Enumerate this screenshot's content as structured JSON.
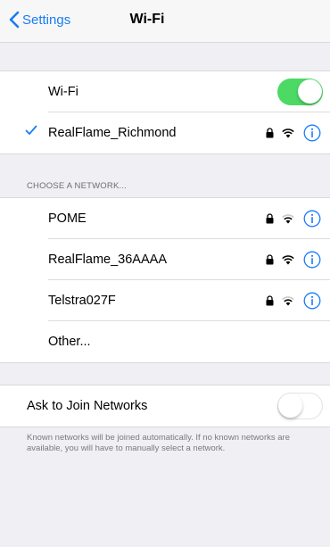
{
  "navbar": {
    "back_label": "Settings",
    "title": "Wi-Fi"
  },
  "wifi_toggle": {
    "label": "Wi-Fi",
    "state": "on"
  },
  "connected_network": {
    "name": "RealFlame_Richmond",
    "secured": true
  },
  "networks_header": "CHOOSE A NETWORK...",
  "networks": [
    {
      "name": "POME",
      "secured": true
    },
    {
      "name": "RealFlame_36AAAA",
      "secured": true
    },
    {
      "name": "Telstra027F",
      "secured": true
    }
  ],
  "other_label": "Other...",
  "ask_to_join": {
    "label": "Ask to Join Networks",
    "state": "off",
    "note": "Known networks will be joined automatically. If no known networks are available, you will have to manually select a network."
  },
  "colors": {
    "accent": "#1a7cf5",
    "toggle_on": "#4cd964",
    "background": "#efeff4"
  },
  "icons": [
    "chevron-left-icon",
    "checkmark-icon",
    "lock-icon",
    "wifi-icon",
    "info-icon"
  ]
}
